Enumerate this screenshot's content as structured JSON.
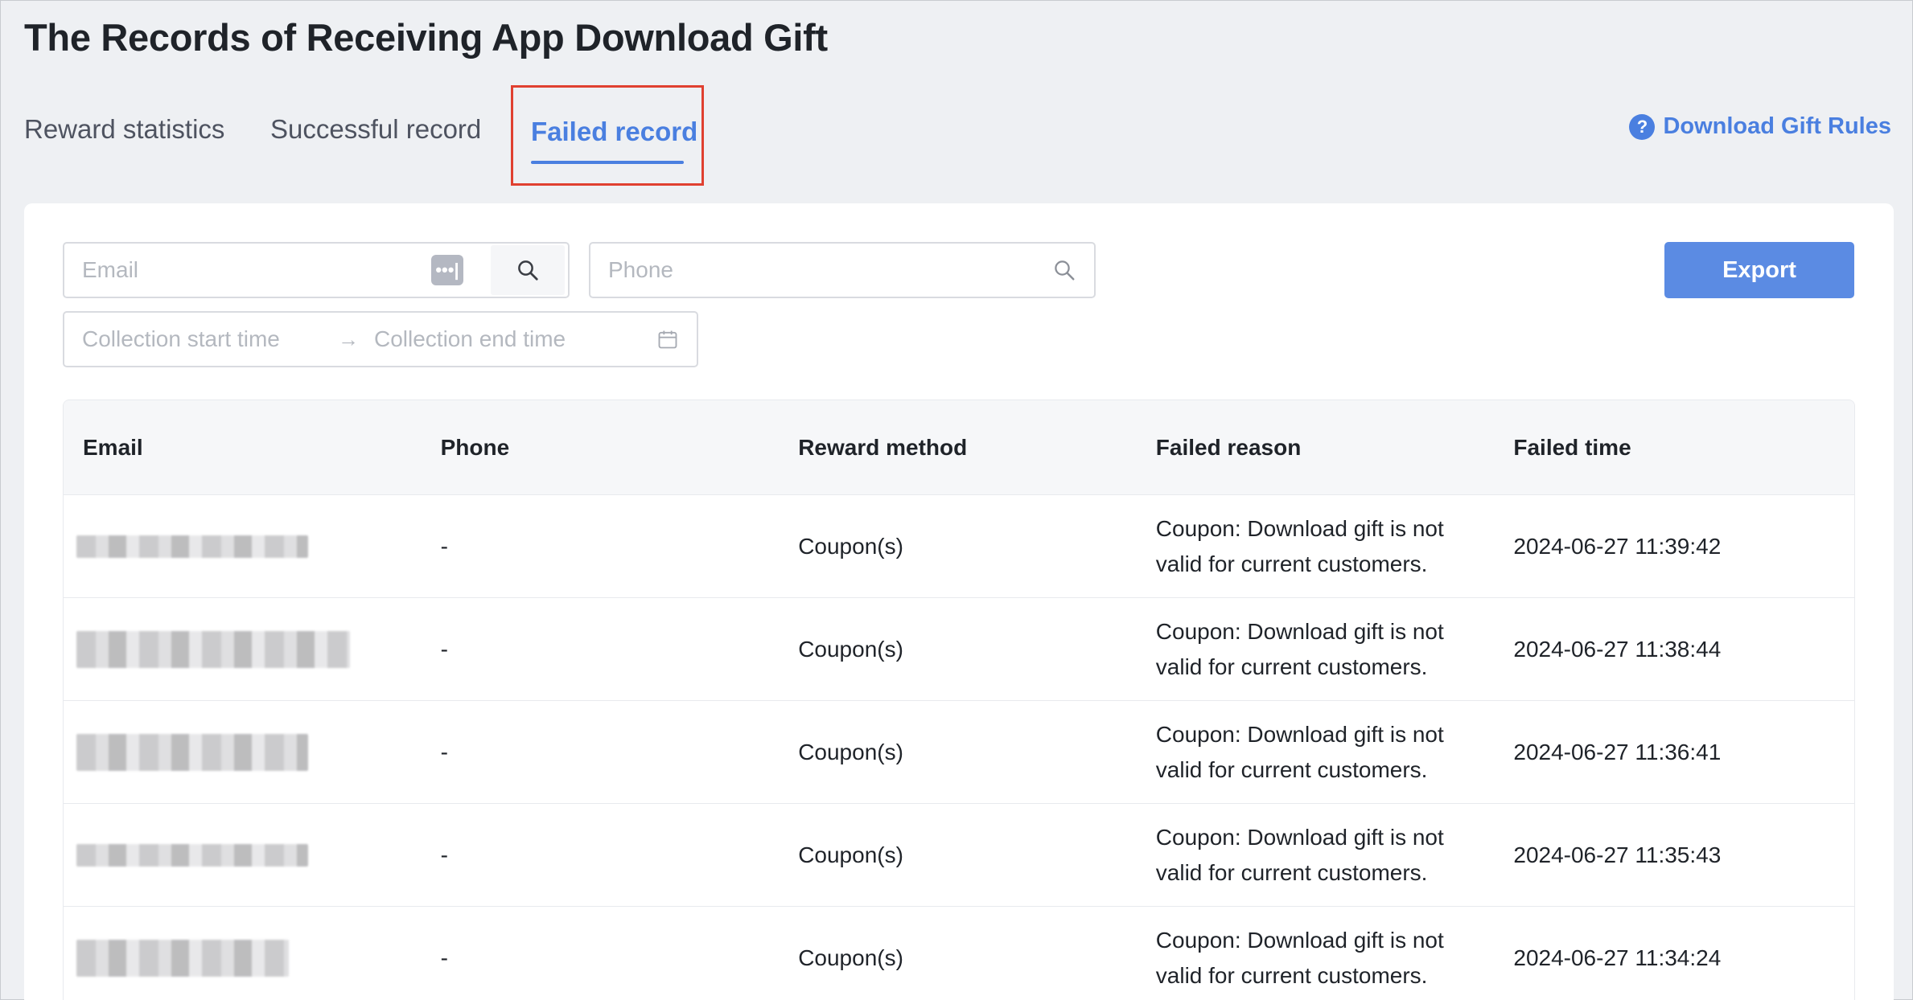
{
  "header": {
    "title": "The Records of Receiving App Download Gift"
  },
  "tabs": [
    {
      "label": "Reward statistics"
    },
    {
      "label": "Successful record"
    },
    {
      "label": "Failed record",
      "active": true
    }
  ],
  "rules_link": {
    "label": "Download Gift Rules",
    "icon": "question-circle-icon"
  },
  "filters": {
    "email_placeholder": "Email",
    "phone_placeholder": "Phone",
    "start_time_placeholder": "Collection start time",
    "end_time_placeholder": "Collection end time",
    "range_separator": "→"
  },
  "export_label": "Export",
  "table": {
    "columns": [
      "Email",
      "Phone",
      "Reward method",
      "Failed reason",
      "Failed time"
    ],
    "rows": [
      {
        "email": "",
        "phone": "-",
        "reward_method": "Coupon(s)",
        "failed_reason_line1": "Coupon: Download gift is not",
        "failed_reason_line2": "valid for current customers.",
        "failed_time": "2024-06-27 11:39:42"
      },
      {
        "email": "",
        "phone": "-",
        "reward_method": "Coupon(s)",
        "failed_reason_line1": "Coupon: Download gift is not",
        "failed_reason_line2": "valid for current customers.",
        "failed_time": "2024-06-27 11:38:44"
      },
      {
        "email": "",
        "phone": "-",
        "reward_method": "Coupon(s)",
        "failed_reason_line1": "Coupon: Download gift is not",
        "failed_reason_line2": "valid for current customers.",
        "failed_time": "2024-06-27 11:36:41"
      },
      {
        "email": "",
        "phone": "-",
        "reward_method": "Coupon(s)",
        "failed_reason_line1": "Coupon: Download gift is not",
        "failed_reason_line2": "valid for current customers.",
        "failed_time": "2024-06-27 11:35:43"
      },
      {
        "email": "",
        "phone": "-",
        "reward_method": "Coupon(s)",
        "failed_reason_line1": "Coupon: Download gift is not",
        "failed_reason_line2": "valid for current customers.",
        "failed_time": "2024-06-27 11:34:24"
      }
    ]
  },
  "colors": {
    "accent": "#4a7fe0",
    "export_button": "#5b8be3",
    "highlight_border": "#e04030"
  }
}
